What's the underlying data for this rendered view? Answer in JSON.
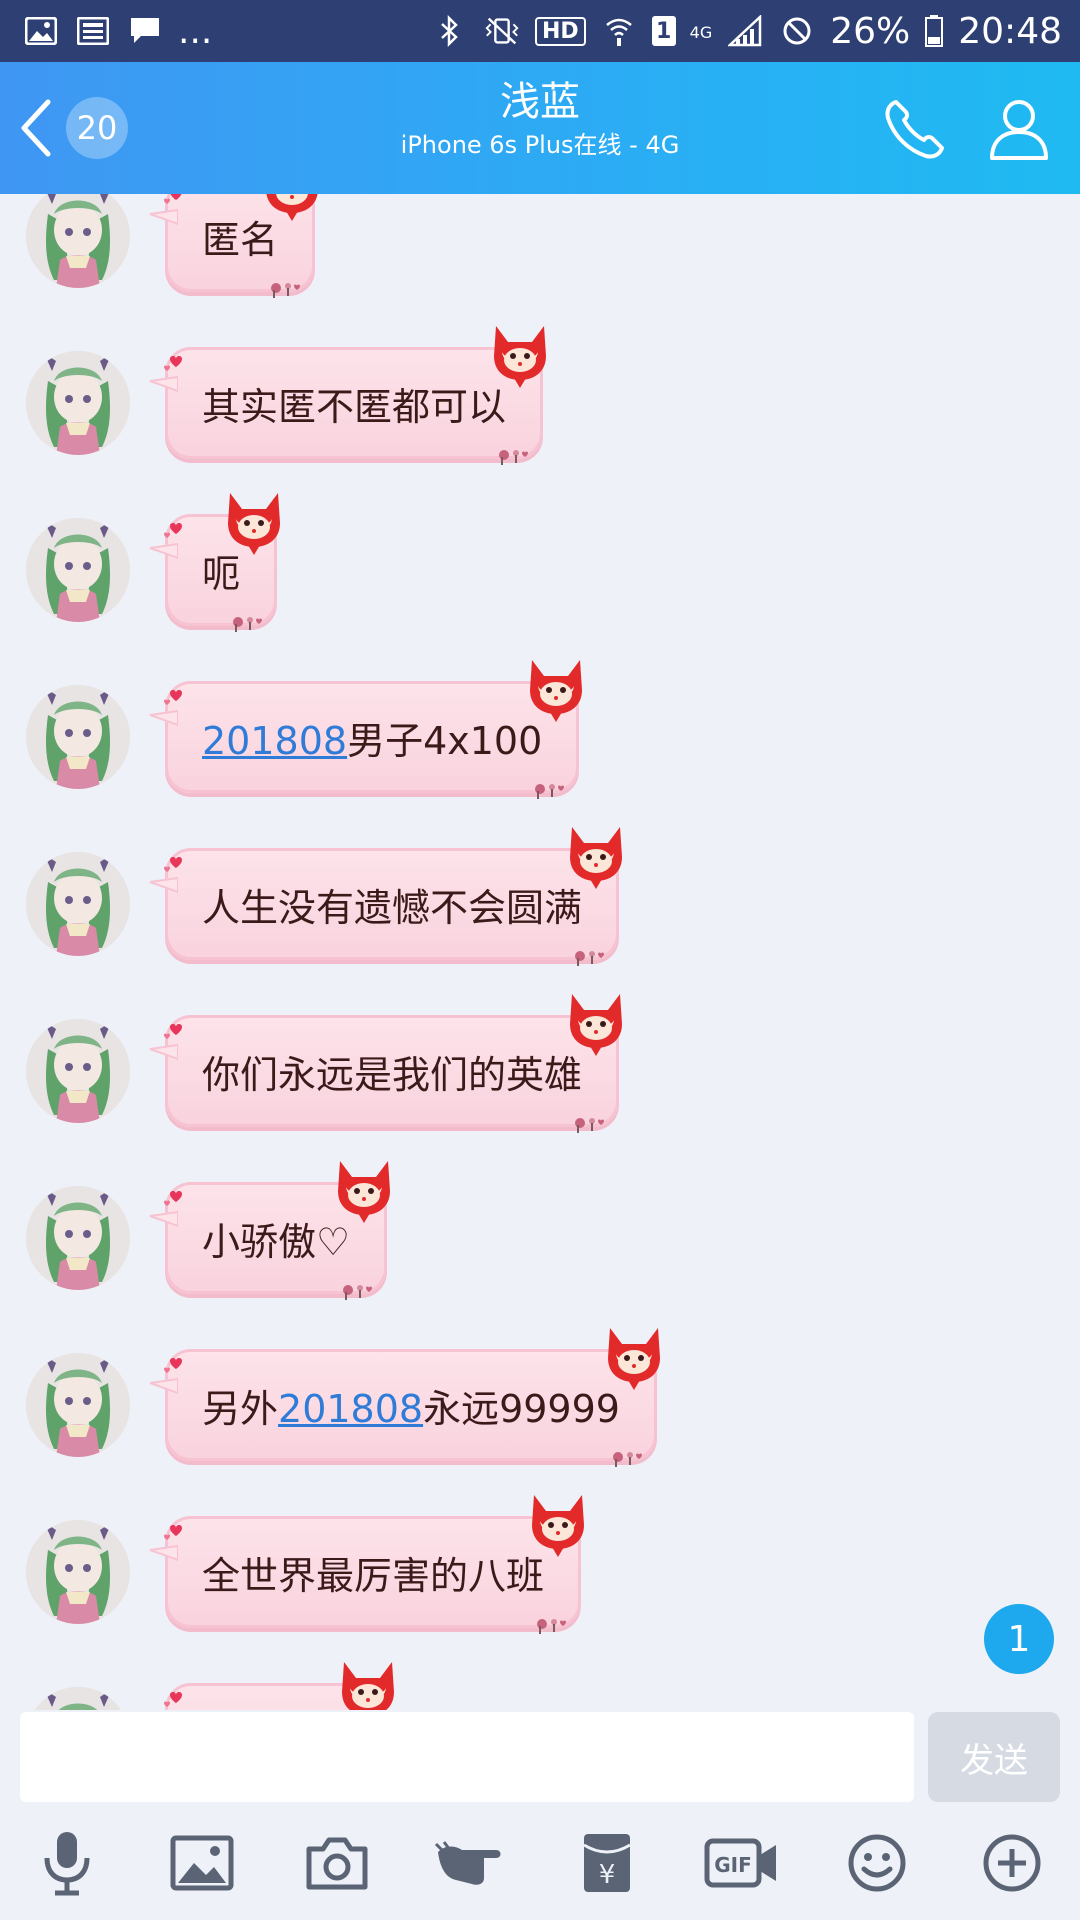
{
  "status_bar": {
    "more": "...",
    "hd": "HD",
    "sim": "1",
    "network": "4G",
    "battery_percent": "26%",
    "time": "20:48"
  },
  "header": {
    "back_badge": "20",
    "title": "浅蓝",
    "subtitle": "iPhone 6s Plus在线 - 4G"
  },
  "messages": [
    {
      "parts": [
        "匿名"
      ]
    },
    {
      "parts": [
        "其实匿不匿都可以"
      ]
    },
    {
      "parts": [
        "呃"
      ]
    },
    {
      "parts": [
        "201808",
        "男子4x100"
      ]
    },
    {
      "parts": [
        "人生没有遗憾不会圆满"
      ]
    },
    {
      "parts": [
        "你们永远是我们的英雄"
      ]
    },
    {
      "parts": [
        "小骄傲♡"
      ]
    },
    {
      "parts": [
        "另外",
        "201808",
        "永远99999"
      ]
    },
    {
      "parts": [
        "全世界最厉害的八班"
      ]
    }
  ],
  "unread_count": "1",
  "input": {
    "placeholder": "",
    "send_label": "发送"
  },
  "toolbar": [
    "microphone-icon",
    "image-icon",
    "camera-icon",
    "poke-icon",
    "red-packet-icon",
    "gif-icon",
    "emoji-icon",
    "plus-icon"
  ],
  "colors": {
    "status_bar": "#2e3f73",
    "header_start": "#3f97f3",
    "header_end": "#1fbaf2",
    "bubble": "#fde3ea",
    "link": "#2e7bd8",
    "unread_badge": "#1ea8ee"
  }
}
